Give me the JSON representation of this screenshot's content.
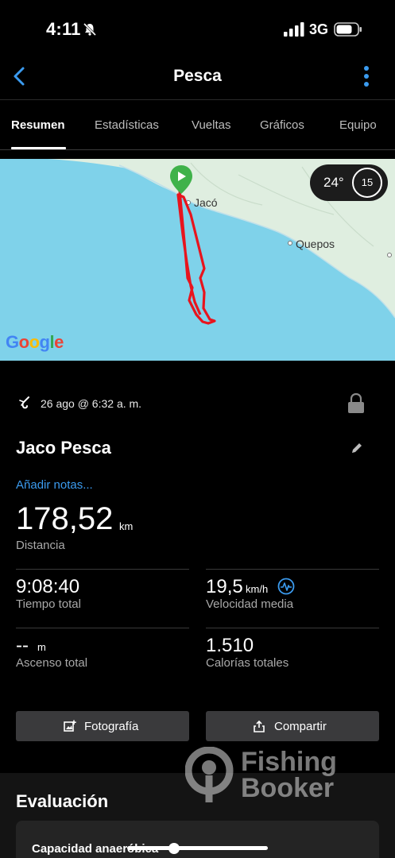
{
  "status_bar": {
    "time": "4:11",
    "network": "3G"
  },
  "nav": {
    "title": "Pesca"
  },
  "tabs": [
    {
      "label": "Resumen"
    },
    {
      "label": "Estadísticas"
    },
    {
      "label": "Vueltas"
    },
    {
      "label": "Gráficos"
    },
    {
      "label": "Equipo"
    }
  ],
  "map": {
    "weather_temp": "24°",
    "wind_speed": "15",
    "places": [
      "Jacó",
      "Quepos"
    ],
    "google": "Google"
  },
  "activity": {
    "date": "26 ago @ 6:32 a. m.",
    "name": "Jaco Pesca",
    "add_notes": "Añadir notas...",
    "distance_value": "178,52",
    "distance_unit": "km",
    "distance_label": "Distancia"
  },
  "stats": {
    "total_time_value": "9:08:40",
    "total_time_label": "Tiempo total",
    "avg_speed_value": "19,5",
    "avg_speed_unit": "km/h",
    "avg_speed_label": "Velocidad media",
    "ascent_value": "--",
    "ascent_unit": "m",
    "ascent_label": "Ascenso total",
    "calories_value": "1.510",
    "calories_label": "Calorías totales"
  },
  "actions": {
    "photo": "Fotografía",
    "share": "Compartir"
  },
  "evaluation": {
    "title": "Evaluación",
    "card_label": "Capacidad anaeróbica"
  },
  "watermark": {
    "line1": "Fishing",
    "line2": "Booker"
  },
  "colors": {
    "accent_blue": "#3b9bef",
    "route_red": "#e8141d",
    "start_green": "#3fb24a",
    "sea": "#7fd2ea",
    "land": "#dfeee0"
  }
}
